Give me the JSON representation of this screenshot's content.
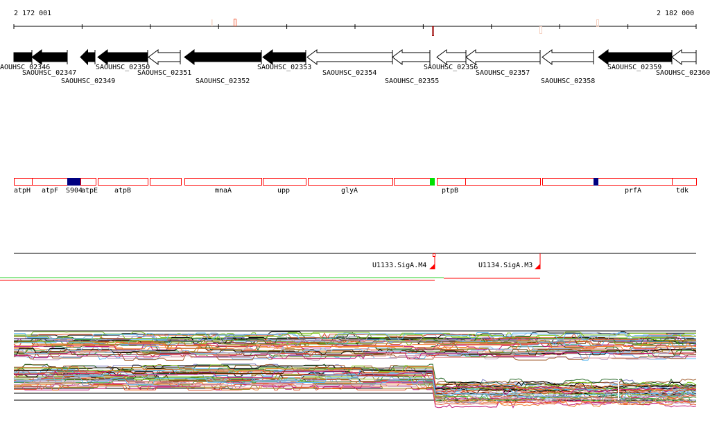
{
  "ruler": {
    "start_label": "2 172 001",
    "end_label": "2 182 000",
    "start": 2172001,
    "end": 2182000
  },
  "genes": [
    {
      "name": "AOUHSC_02346",
      "filled": true
    },
    {
      "name": "SAOUHSC_02347",
      "filled": true
    },
    {
      "name": "SAOUHSC_02349",
      "filled": true
    },
    {
      "name": "SAOUHSC_02350",
      "filled": true
    },
    {
      "name": "SAOUHSC_02351",
      "filled": false
    },
    {
      "name": "SAOUHSC_02352",
      "filled": true
    },
    {
      "name": "SAOUHSC_02353",
      "filled": true
    },
    {
      "name": "SAOUHSC_02354",
      "filled": false
    },
    {
      "name": "SAOUHSC_02355",
      "filled": false
    },
    {
      "name": "SAOUHSC_02356",
      "filled": false
    },
    {
      "name": "SAOUHSC_02357",
      "filled": false
    },
    {
      "name": "SAOUHSC_02358",
      "filled": false
    },
    {
      "name": "SAOUHSC_02359",
      "filled": true
    },
    {
      "name": "SAOUHSC_02360",
      "filled": false
    }
  ],
  "features": [
    "atpH",
    "atpF",
    "S904",
    "atpE",
    "atpB",
    "mnaA",
    "upp",
    "glyA",
    "ptpB",
    "prfA",
    "tdk"
  ],
  "promoters": [
    "U1133.SigA.M4",
    "U1134.SigA.M3"
  ],
  "colors": {
    "feature_outline": "#ff0000",
    "blue_mark": "#000080",
    "green_mark": "#00e000",
    "trace_palette": [
      "#000000",
      "#e0502a",
      "#8db3e2",
      "#7fc31c",
      "#9e8a2a",
      "#c0197a",
      "#f07c30",
      "#5bb8f0",
      "#a05a2c",
      "#d94040",
      "#8080c0",
      "#2a6a2a",
      "#c0a0c0",
      "#40a040",
      "#e8a0a0",
      "#603000"
    ]
  }
}
